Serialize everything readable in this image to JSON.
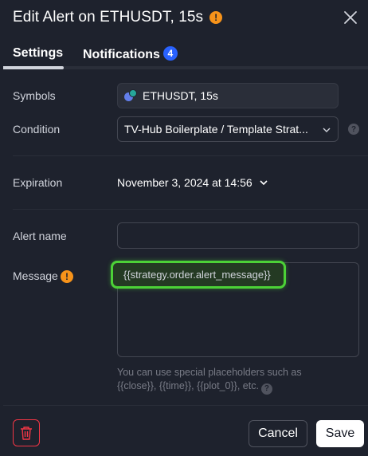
{
  "dialog": {
    "title": "Edit Alert on ETHUSDT, 15s",
    "warning_icon": "!"
  },
  "tabs": [
    {
      "label": "Settings",
      "active": true
    },
    {
      "label": "Notifications",
      "badge": "4"
    }
  ],
  "fields": {
    "symbols": {
      "label": "Symbols",
      "value": "ETHUSDT, 15s"
    },
    "condition": {
      "label": "Condition",
      "value": "TV-Hub Boilerplate / Template Strat..."
    },
    "expiration": {
      "label": "Expiration",
      "value": "November 3, 2024 at 14:56"
    },
    "alert_name": {
      "label": "Alert name",
      "value": ""
    },
    "message": {
      "label": "Message",
      "value": "{{strategy.order.alert_message}}"
    }
  },
  "hint": {
    "line1": "You can use special placeholders such as",
    "line2": "{{close}}, {{time}}, {{plot_0}}, etc."
  },
  "help_glyph": "?",
  "footer": {
    "cancel_label": "Cancel",
    "save_label": "Save"
  },
  "colors": {
    "background": "#1e222d",
    "accent_badge": "#2962ff",
    "warning": "#f7931a",
    "highlight": "#4cd137",
    "danger": "#f23645"
  }
}
